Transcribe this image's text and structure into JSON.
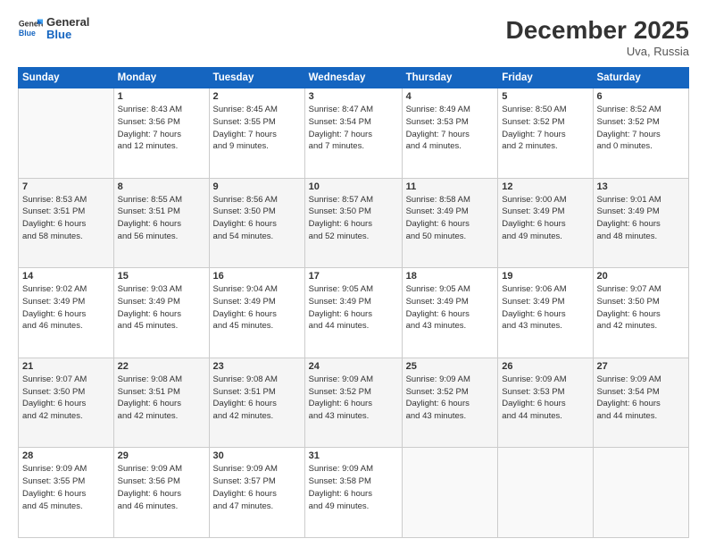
{
  "logo": {
    "line1": "General",
    "line2": "Blue"
  },
  "title": "December 2025",
  "location": "Uva, Russia",
  "days_header": [
    "Sunday",
    "Monday",
    "Tuesday",
    "Wednesday",
    "Thursday",
    "Friday",
    "Saturday"
  ],
  "weeks": [
    [
      {
        "day": "",
        "info": ""
      },
      {
        "day": "1",
        "info": "Sunrise: 8:43 AM\nSunset: 3:56 PM\nDaylight: 7 hours\nand 12 minutes."
      },
      {
        "day": "2",
        "info": "Sunrise: 8:45 AM\nSunset: 3:55 PM\nDaylight: 7 hours\nand 9 minutes."
      },
      {
        "day": "3",
        "info": "Sunrise: 8:47 AM\nSunset: 3:54 PM\nDaylight: 7 hours\nand 7 minutes."
      },
      {
        "day": "4",
        "info": "Sunrise: 8:49 AM\nSunset: 3:53 PM\nDaylight: 7 hours\nand 4 minutes."
      },
      {
        "day": "5",
        "info": "Sunrise: 8:50 AM\nSunset: 3:52 PM\nDaylight: 7 hours\nand 2 minutes."
      },
      {
        "day": "6",
        "info": "Sunrise: 8:52 AM\nSunset: 3:52 PM\nDaylight: 7 hours\nand 0 minutes."
      }
    ],
    [
      {
        "day": "7",
        "info": "Sunrise: 8:53 AM\nSunset: 3:51 PM\nDaylight: 6 hours\nand 58 minutes."
      },
      {
        "day": "8",
        "info": "Sunrise: 8:55 AM\nSunset: 3:51 PM\nDaylight: 6 hours\nand 56 minutes."
      },
      {
        "day": "9",
        "info": "Sunrise: 8:56 AM\nSunset: 3:50 PM\nDaylight: 6 hours\nand 54 minutes."
      },
      {
        "day": "10",
        "info": "Sunrise: 8:57 AM\nSunset: 3:50 PM\nDaylight: 6 hours\nand 52 minutes."
      },
      {
        "day": "11",
        "info": "Sunrise: 8:58 AM\nSunset: 3:49 PM\nDaylight: 6 hours\nand 50 minutes."
      },
      {
        "day": "12",
        "info": "Sunrise: 9:00 AM\nSunset: 3:49 PM\nDaylight: 6 hours\nand 49 minutes."
      },
      {
        "day": "13",
        "info": "Sunrise: 9:01 AM\nSunset: 3:49 PM\nDaylight: 6 hours\nand 48 minutes."
      }
    ],
    [
      {
        "day": "14",
        "info": "Sunrise: 9:02 AM\nSunset: 3:49 PM\nDaylight: 6 hours\nand 46 minutes."
      },
      {
        "day": "15",
        "info": "Sunrise: 9:03 AM\nSunset: 3:49 PM\nDaylight: 6 hours\nand 45 minutes."
      },
      {
        "day": "16",
        "info": "Sunrise: 9:04 AM\nSunset: 3:49 PM\nDaylight: 6 hours\nand 45 minutes."
      },
      {
        "day": "17",
        "info": "Sunrise: 9:05 AM\nSunset: 3:49 PM\nDaylight: 6 hours\nand 44 minutes."
      },
      {
        "day": "18",
        "info": "Sunrise: 9:05 AM\nSunset: 3:49 PM\nDaylight: 6 hours\nand 43 minutes."
      },
      {
        "day": "19",
        "info": "Sunrise: 9:06 AM\nSunset: 3:49 PM\nDaylight: 6 hours\nand 43 minutes."
      },
      {
        "day": "20",
        "info": "Sunrise: 9:07 AM\nSunset: 3:50 PM\nDaylight: 6 hours\nand 42 minutes."
      }
    ],
    [
      {
        "day": "21",
        "info": "Sunrise: 9:07 AM\nSunset: 3:50 PM\nDaylight: 6 hours\nand 42 minutes."
      },
      {
        "day": "22",
        "info": "Sunrise: 9:08 AM\nSunset: 3:51 PM\nDaylight: 6 hours\nand 42 minutes."
      },
      {
        "day": "23",
        "info": "Sunrise: 9:08 AM\nSunset: 3:51 PM\nDaylight: 6 hours\nand 42 minutes."
      },
      {
        "day": "24",
        "info": "Sunrise: 9:09 AM\nSunset: 3:52 PM\nDaylight: 6 hours\nand 43 minutes."
      },
      {
        "day": "25",
        "info": "Sunrise: 9:09 AM\nSunset: 3:52 PM\nDaylight: 6 hours\nand 43 minutes."
      },
      {
        "day": "26",
        "info": "Sunrise: 9:09 AM\nSunset: 3:53 PM\nDaylight: 6 hours\nand 44 minutes."
      },
      {
        "day": "27",
        "info": "Sunrise: 9:09 AM\nSunset: 3:54 PM\nDaylight: 6 hours\nand 44 minutes."
      }
    ],
    [
      {
        "day": "28",
        "info": "Sunrise: 9:09 AM\nSunset: 3:55 PM\nDaylight: 6 hours\nand 45 minutes."
      },
      {
        "day": "29",
        "info": "Sunrise: 9:09 AM\nSunset: 3:56 PM\nDaylight: 6 hours\nand 46 minutes."
      },
      {
        "day": "30",
        "info": "Sunrise: 9:09 AM\nSunset: 3:57 PM\nDaylight: 6 hours\nand 47 minutes."
      },
      {
        "day": "31",
        "info": "Sunrise: 9:09 AM\nSunset: 3:58 PM\nDaylight: 6 hours\nand 49 minutes."
      },
      {
        "day": "",
        "info": ""
      },
      {
        "day": "",
        "info": ""
      },
      {
        "day": "",
        "info": ""
      }
    ]
  ]
}
